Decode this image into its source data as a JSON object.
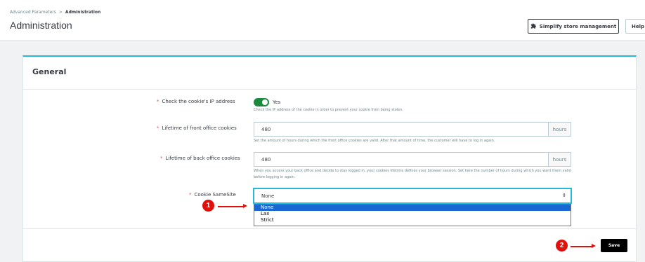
{
  "header": {
    "breadcrumb": {
      "parent": "Advanced Parameters",
      "separator": ">",
      "current": "Administration"
    },
    "title": "Administration",
    "simplify_label": "Simplify store management",
    "simplify_icon": "puzzle-icon",
    "help_label": "Help"
  },
  "card": {
    "title": "General",
    "fields": {
      "ip_check": {
        "label": "Check the cookie's IP address",
        "required": "*",
        "toggle_value": "Yes",
        "help": "Check the IP address of the cookie in order to prevent your cookie from being stolen."
      },
      "front_lifetime": {
        "label": "Lifetime of front office cookies",
        "required": "*",
        "value": "480",
        "unit": "hours",
        "help": "Set the amount of hours during which the front office cookies are valid. After that amount of time, the customer will have to log in again."
      },
      "back_lifetime": {
        "label": "Lifetime of back office cookies",
        "required": "*",
        "value": "480",
        "unit": "hours",
        "help": "When you access your back office and decide to stay logged in, your cookies lifetime defines your browser session. Set here the number of hours during which you want them valid before logging in again."
      },
      "samesite": {
        "label": "Cookie SameSite",
        "required": "*",
        "value": "None",
        "options": [
          "None",
          "Lax",
          "Strict"
        ]
      }
    },
    "save_label": "Save"
  },
  "annotations": {
    "one": "1",
    "two": "2"
  },
  "colors": {
    "accent": "#25b9d7",
    "toggle_on": "#1a8b3c",
    "callout": "#e0100b",
    "selected_option": "#1967d2"
  }
}
